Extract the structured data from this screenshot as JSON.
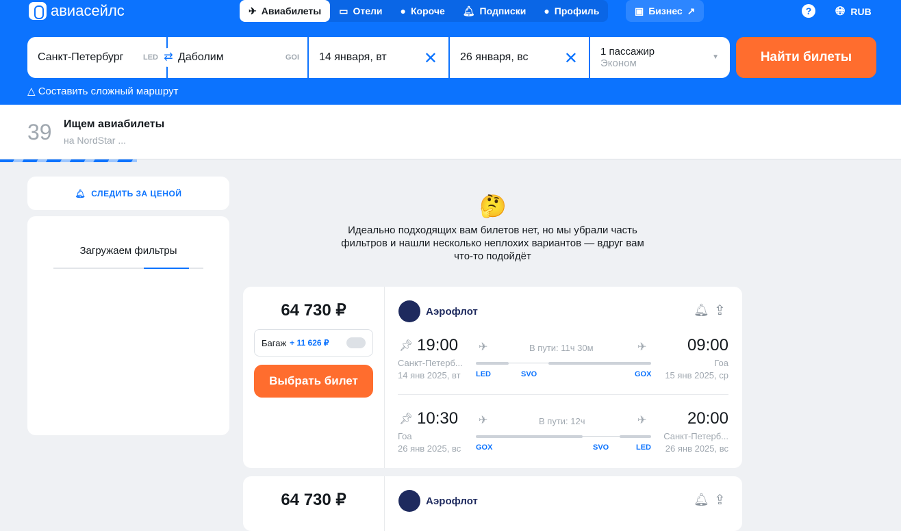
{
  "header": {
    "logo": "авиасейлс",
    "nav": [
      {
        "label": "Авиабилеты",
        "icon": "plane-icon",
        "active": true
      },
      {
        "label": "Отели",
        "icon": "bed-icon"
      },
      {
        "label": "Короче",
        "icon": "pin-icon"
      },
      {
        "label": "Подписки",
        "icon": "bell-icon"
      },
      {
        "label": "Профиль",
        "icon": "user-icon"
      }
    ],
    "business": "Бизнес",
    "help": "?",
    "currency": "RUB"
  },
  "search": {
    "origin": "Санкт-Петербург",
    "origin_code": "LED",
    "destination": "Даболим",
    "destination_code": "GOI",
    "date_from": "14 января, вт",
    "date_back": "26 января, вс",
    "passengers": "1 пассажир",
    "class": "Эконом",
    "find_button": "Найти билеты",
    "complex_route": "Составить сложный маршрут"
  },
  "status": {
    "count": "39",
    "title": "Ищем авиабилеты",
    "subtitle": "на NordStar ...",
    "progress": 0.15
  },
  "sidebar": {
    "price_alert": "СЛЕДИТЬ ЗА ЦЕНОЙ",
    "filters_loading": "Загружаем фильтры"
  },
  "notice": {
    "emoji": "🤔",
    "lines": [
      "Идеально подходящих вам билетов нет, но мы убрали часть",
      "фильтров и нашли несколько неплохих вариантов — вдруг вам",
      "что-то подойдёт"
    ]
  },
  "tickets": [
    {
      "price": "64 730 ₽",
      "baggage_label": "Багаж",
      "baggage_price": "+ 11 626 ₽",
      "select": "Выбрать билет",
      "airline": "Аэрофлот",
      "segments": [
        {
          "dep_time": "19:00",
          "dep_city": "Санкт-Петерб...",
          "dep_date": "14 янв 2025, вт",
          "duration": "В пути: 11ч 30м",
          "arr_time": "09:00",
          "arr_city": "Гоа",
          "arr_date": "15 янв 2025, ср",
          "codes": [
            "LED",
            "SVO",
            "GOX"
          ]
        },
        {
          "dep_time": "10:30",
          "dep_city": "Гоа",
          "dep_date": "26 янв 2025, вс",
          "duration": "В пути: 12ч",
          "arr_time": "20:00",
          "arr_city": "Санкт-Петерб...",
          "arr_date": "26 янв 2025, вс",
          "codes": [
            "GOX",
            "SVO",
            "LED"
          ]
        }
      ]
    },
    {
      "price": "64 730 ₽",
      "airline": "Аэрофлот"
    }
  ]
}
